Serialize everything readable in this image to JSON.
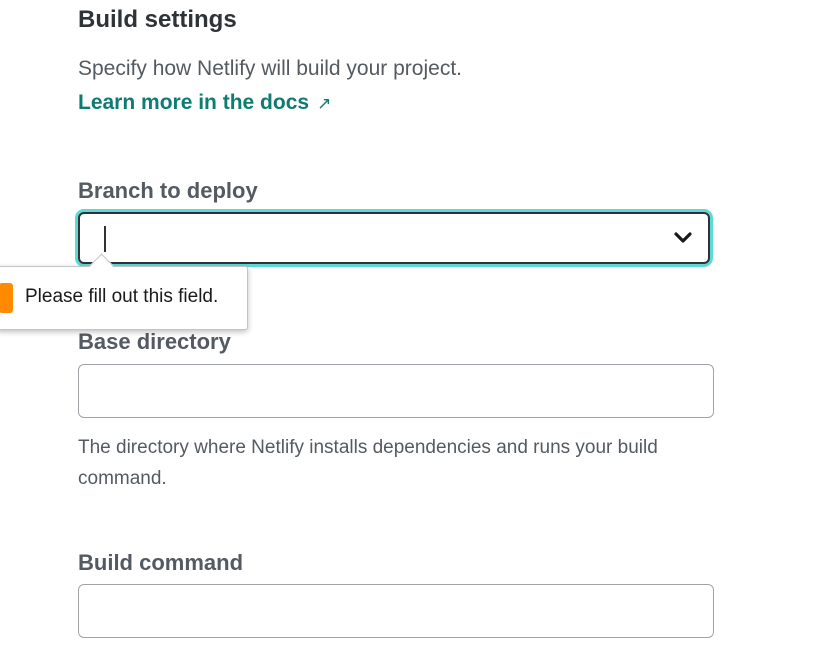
{
  "section": {
    "title": "Build settings",
    "subtitle": "Specify how Netlify will build your project.",
    "docs_link": "Learn more in the docs",
    "docs_link_icon": "external-arrow-icon"
  },
  "fields": {
    "branch": {
      "label": "Branch to deploy",
      "value": ""
    },
    "base_directory": {
      "label": "Base directory",
      "value": "",
      "help": "The directory where Netlify installs dependencies and runs your build command."
    },
    "build_command": {
      "label": "Build command",
      "value": ""
    }
  },
  "validation_tooltip": {
    "message": "Please fill out this field.",
    "icon": "warning-icon"
  },
  "colors": {
    "link": "#0e7c72",
    "focus_ring": "#5fd8d5",
    "warning": "#ff8a00"
  }
}
